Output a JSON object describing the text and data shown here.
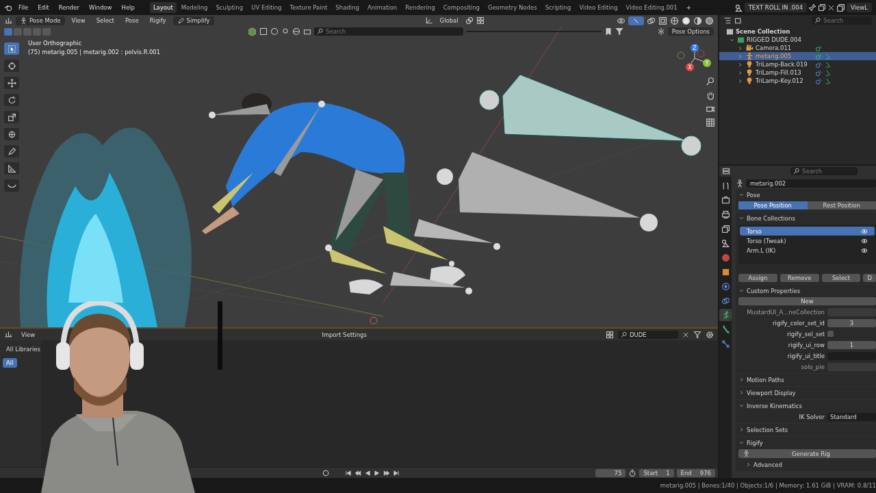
{
  "topbar": {
    "menus": [
      "File",
      "Edit",
      "Render",
      "Window",
      "Help"
    ],
    "workspaces": [
      {
        "label": "Layout",
        "selected": true
      },
      {
        "label": "Modeling",
        "selected": false
      },
      {
        "label": "Sculpting",
        "selected": false
      },
      {
        "label": "UV Editing",
        "selected": false
      },
      {
        "label": "Texture Paint",
        "selected": false
      },
      {
        "label": "Shading",
        "selected": false
      },
      {
        "label": "Animation",
        "selected": false
      },
      {
        "label": "Rendering",
        "selected": false
      },
      {
        "label": "Compositing",
        "selected": false
      },
      {
        "label": "Geometry Nodes",
        "selected": false
      },
      {
        "label": "Scripting",
        "selected": false
      },
      {
        "label": "Video Editing",
        "selected": false
      },
      {
        "label": "Video Editing.001",
        "selected": false
      }
    ],
    "add_tab": "+",
    "scene": "TEXT ROLL IN .004",
    "view_layer": "ViewL"
  },
  "viewport": {
    "mode": "Pose Mode",
    "menus": [
      "View",
      "Select",
      "Pose",
      "Rigify"
    ],
    "simplify": "Simplify",
    "orientation": "Global",
    "search_placeholder": "Search",
    "pose_options": "Pose Options",
    "view_name": "User Orthographic",
    "active_info": "(75) metarig.005 | metarig.002 : pelvis.R.001",
    "gizmo_axes": [
      "Z",
      "Y",
      "X"
    ],
    "tools": [
      {
        "kind": "select",
        "selected": true
      },
      {
        "kind": "cursor",
        "selected": false
      },
      {
        "kind": "move",
        "selected": false
      },
      {
        "kind": "rotate",
        "selected": false
      },
      {
        "kind": "scale",
        "selected": false
      },
      {
        "kind": "transform",
        "selected": false
      },
      {
        "kind": "annotate",
        "selected": false
      },
      {
        "kind": "measure",
        "selected": false
      },
      {
        "kind": "relax",
        "selected": false
      }
    ]
  },
  "outliner": {
    "search_placeholder": "Search",
    "root": "Scene Collection",
    "collections": [
      {
        "name": "RIGGED DUDE.004",
        "expanded": true,
        "children": [
          {
            "name": "Camera.011",
            "kind": "camera",
            "selected": false
          },
          {
            "name": "metarig.005",
            "kind": "armature",
            "selected": true
          },
          {
            "name": "TriLamp-Back.019",
            "kind": "light",
            "selected": false
          },
          {
            "name": "TriLamp-Fill.013",
            "kind": "light",
            "selected": false
          },
          {
            "name": "TriLamp-Key.012",
            "kind": "light",
            "selected": false
          }
        ]
      }
    ]
  },
  "properties": {
    "search_placeholder": "Search",
    "data_name": "metarig.002",
    "prop_tabs": [
      {
        "kind": "tool",
        "selected": false
      },
      {
        "kind": "render",
        "selected": false
      },
      {
        "kind": "output",
        "selected": false
      },
      {
        "kind": "view_layer",
        "selected": false
      },
      {
        "kind": "scene",
        "selected": false
      },
      {
        "kind": "world",
        "selected": false
      },
      {
        "kind": "object",
        "selected": false
      },
      {
        "kind": "physics",
        "selected": false
      },
      {
        "kind": "constraints",
        "selected": false
      },
      {
        "kind": "data",
        "selected": true
      },
      {
        "kind": "bone",
        "selected": false
      },
      {
        "kind": "bone_constraint",
        "selected": false
      }
    ],
    "panels": [
      {
        "kind": "pose",
        "title": "Pose",
        "expanded": true,
        "options": [
          {
            "label": "Pose Position",
            "selected": true
          },
          {
            "label": "Rest Position",
            "selected": false
          }
        ]
      },
      {
        "kind": "bone_collections",
        "title": "Bone Collections",
        "expanded": true,
        "items": [
          {
            "name": "Torso",
            "selected": true
          },
          {
            "name": "Torso (Tweak)",
            "selected": false
          },
          {
            "name": "Arm.L (IK)",
            "selected": false
          }
        ],
        "buttons": [
          "Assign",
          "Remove",
          "Select",
          "D"
        ]
      },
      {
        "kind": "custom_properties",
        "title": "Custom Properties",
        "expanded": true,
        "new_button": "New",
        "props": [
          {
            "label": "MustardUI_A...neCollection",
            "kind": "text",
            "disabled": true
          },
          {
            "label": "rigify_color_set_id",
            "kind": "number",
            "value": "3",
            "disabled": false
          },
          {
            "label": "rigify_sel_set",
            "kind": "checkbox",
            "checked": false,
            "disabled": false
          },
          {
            "label": "rigify_ui_row",
            "kind": "number",
            "value": "1",
            "disabled": false
          },
          {
            "label": "rigify_ui_title",
            "kind": "text",
            "disabled": false
          },
          {
            "label": "solo_pie",
            "kind": "text",
            "disabled": true
          }
        ]
      },
      {
        "title": "Motion Paths",
        "expanded": false
      },
      {
        "title": "Viewport Display",
        "expanded": false
      },
      {
        "kind": "ik",
        "title": "Inverse Kinematics",
        "expanded": true,
        "solver_label": "IK Solver",
        "solver": "Standard"
      },
      {
        "title": "Selection Sets",
        "expanded": false
      },
      {
        "kind": "rigify",
        "title": "Rigify",
        "expanded": true,
        "button": "Generate Rig",
        "sub": {
          "title": "Advanced",
          "expanded": false
        }
      }
    ]
  },
  "asset_browser": {
    "menus": [
      "View"
    ],
    "import_settings": "Import Settings",
    "search_value": "DUDE",
    "libraries": [
      {
        "label": "All Libraries",
        "selected": false
      },
      {
        "label": "All",
        "selected": true
      }
    ]
  },
  "timeline": {
    "frame": "75",
    "start_label": "Start",
    "start": "1",
    "end_label": "End",
    "end": "976"
  },
  "status_bar": "metarig.005 | Bones:1/40 | Objects:1/6 | Memory: 1.61 GiB | VRAM: 0.8/11"
}
